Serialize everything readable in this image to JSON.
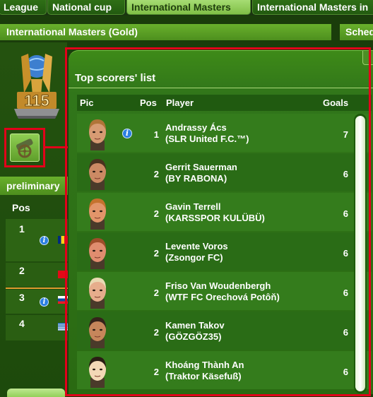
{
  "tabs": [
    {
      "label": "League",
      "active": false
    },
    {
      "label": "National cup",
      "active": false
    },
    {
      "label": "International Masters",
      "active": true
    },
    {
      "label": "International Masters in",
      "active": false
    }
  ],
  "section": {
    "title": "International Masters (Gold)",
    "schedule_label": "Sched"
  },
  "trophy": {
    "number": "115"
  },
  "preliminary": {
    "label": "preliminary"
  },
  "standings": {
    "pos_header": "Pos",
    "rows": [
      {
        "pos": "1",
        "flag": "romania"
      },
      {
        "pos": "2",
        "flag": "turkey"
      },
      {
        "pos": "3",
        "flag": "slovakia"
      },
      {
        "pos": "4",
        "flag": "greece"
      }
    ]
  },
  "modal": {
    "title": "Top scorers' list",
    "columns": {
      "pic": "Pic",
      "pos": "Pos",
      "player": "Player",
      "goals": "Goals"
    },
    "players": [
      {
        "pos": "1",
        "name": "Andrassy Ács",
        "club": "(SLR United F.C.™)",
        "goals": "7",
        "info": true,
        "skin": "#d79b73",
        "hair": "#b07438"
      },
      {
        "pos": "2",
        "name": "Gerrit Sauerman",
        "club": "(BY RABONA)",
        "goals": "6",
        "info": false,
        "skin": "#cc8a64",
        "hair": "#4a321f"
      },
      {
        "pos": "2",
        "name": "Gavin Terrell",
        "club": "(KARSSPOR KULÜBÜ)",
        "goals": "6",
        "info": false,
        "skin": "#e2956a",
        "hair": "#c5722e"
      },
      {
        "pos": "2",
        "name": "Levente Voros",
        "club": "(Zsongor FC)",
        "goals": "6",
        "info": false,
        "skin": "#e08d6f",
        "hair": "#9e4e2a"
      },
      {
        "pos": "2",
        "name": "Friso Van Woudenbergh",
        "club": "(WTF FC Orechová Potôň)",
        "goals": "6",
        "info": false,
        "skin": "#e6ad8c",
        "hair": "#e9d9b2"
      },
      {
        "pos": "2",
        "name": "Kamen Takov",
        "club": "(GÖZGÖZ35)",
        "goals": "6",
        "info": false,
        "skin": "#c6865b",
        "hair": "#35231a"
      },
      {
        "pos": "2",
        "name": "Khoáng Thành An",
        "club": "(Traktor Käsefuß)",
        "goals": "6",
        "info": false,
        "skin": "#f3d8b6",
        "hair": "#2a1d14"
      }
    ]
  }
}
